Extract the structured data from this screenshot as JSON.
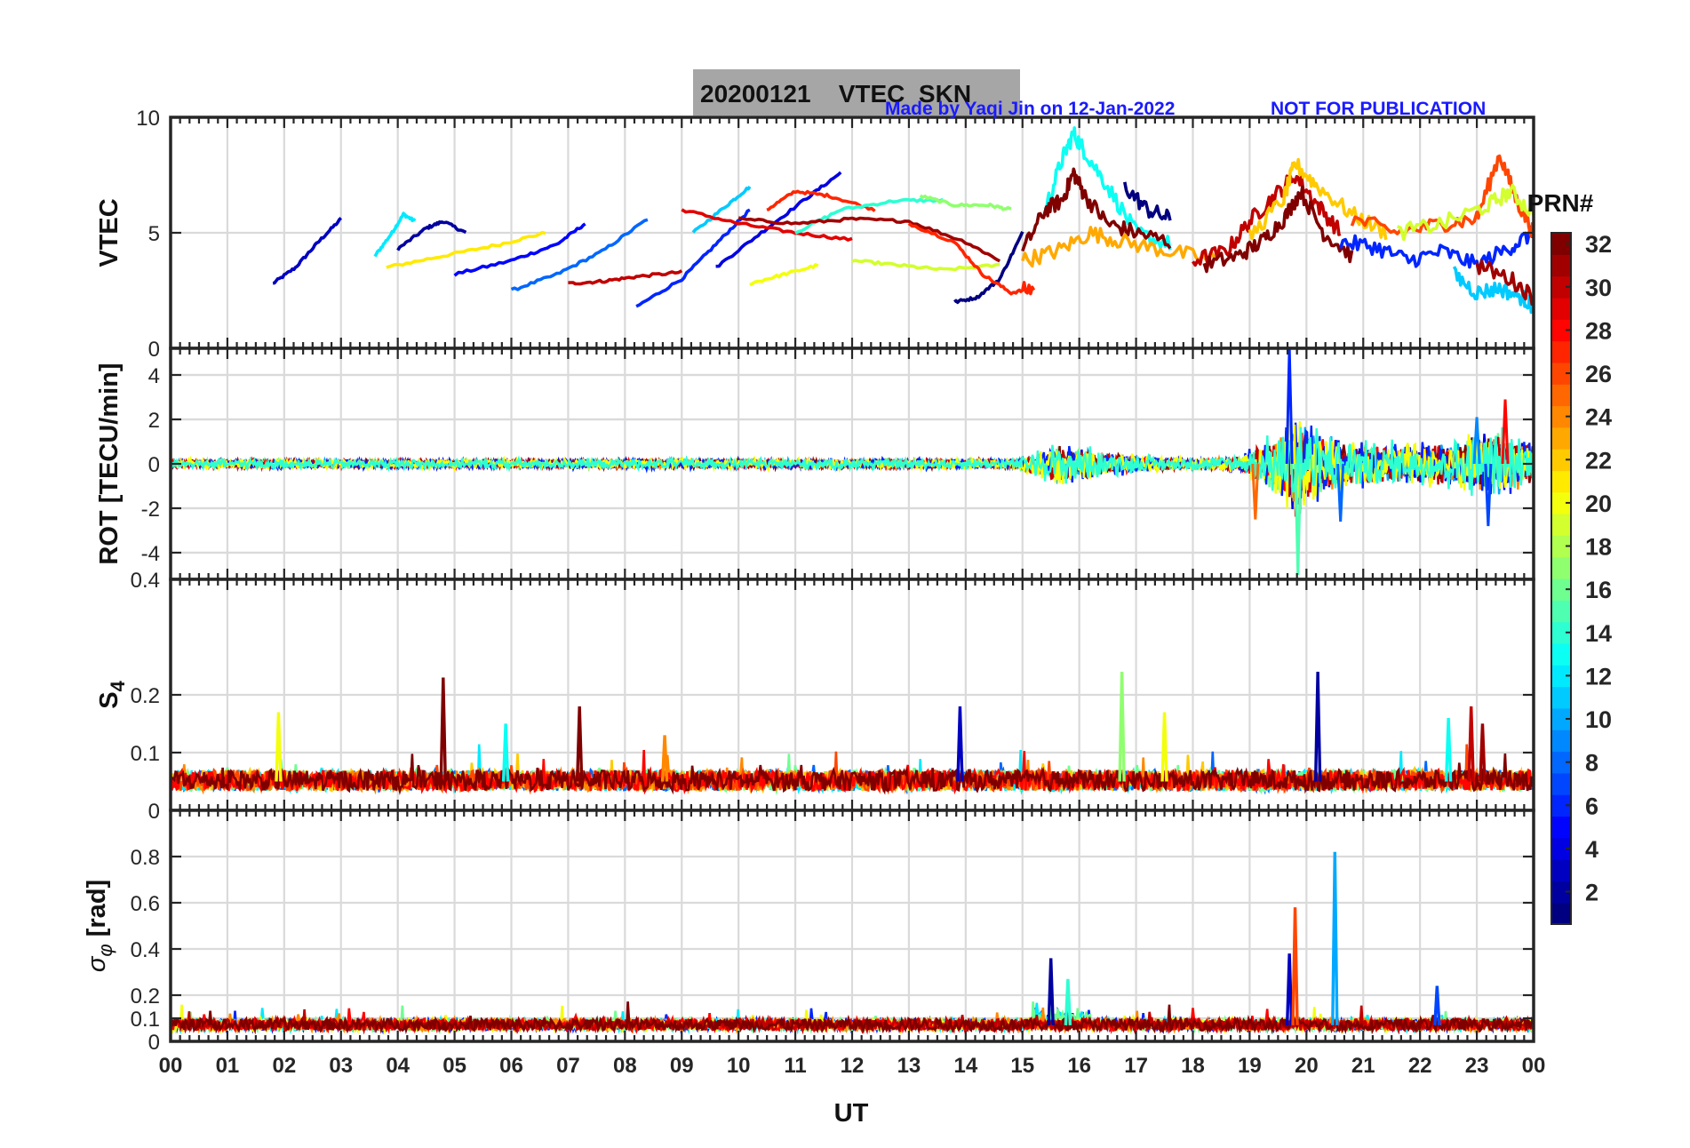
{
  "header": {
    "title": "20200121    VTEC  SKN",
    "credit": "Made by Yaqi Jin on 12-Jan-2022",
    "notice": "NOT FOR PUBLICATION"
  },
  "colors": {
    "title_box": "#a6a6a6",
    "credit_text": "#1a1aff",
    "grid": "#d9d9d9",
    "axes": "#262626"
  },
  "chart_data": [
    {
      "type": "line",
      "panel": "vtec",
      "ylabel": "VTEC",
      "ylim": [
        0,
        10
      ],
      "yticks": [
        0,
        5,
        10
      ],
      "xlim": [
        0,
        24
      ],
      "grid": true,
      "series_description_color_by": "PRN#",
      "series": [
        {
          "prn": 3,
          "x": [
            1.8,
            2.2,
            2.6,
            3.0
          ],
          "y": [
            2.8,
            3.5,
            4.6,
            5.6
          ]
        },
        {
          "prn": 12,
          "x": [
            3.6,
            3.9,
            4.1,
            4.3
          ],
          "y": [
            4.0,
            5.0,
            5.8,
            5.5
          ]
        },
        {
          "prn": 2,
          "x": [
            4.0,
            4.5,
            4.8,
            5.2
          ],
          "y": [
            4.3,
            5.2,
            5.5,
            5.0
          ]
        },
        {
          "prn": 21,
          "x": [
            3.8,
            4.8,
            5.8,
            6.6
          ],
          "y": [
            3.5,
            4.0,
            4.5,
            5.0
          ]
        },
        {
          "prn": 5,
          "x": [
            5.0,
            6.0,
            6.8,
            7.3
          ],
          "y": [
            3.2,
            3.8,
            4.5,
            5.4
          ]
        },
        {
          "prn": 8,
          "x": [
            6.0,
            6.8,
            7.6,
            8.4
          ],
          "y": [
            2.5,
            3.2,
            4.2,
            5.6
          ]
        },
        {
          "prn": 30,
          "x": [
            7.0,
            7.6,
            8.2,
            9.0
          ],
          "y": [
            2.8,
            2.9,
            3.1,
            3.3
          ]
        },
        {
          "prn": 6,
          "x": [
            8.2,
            9.0,
            9.6,
            10.2
          ],
          "y": [
            1.8,
            3.0,
            4.5,
            6.0
          ]
        },
        {
          "prn": 11,
          "x": [
            9.2,
            9.8,
            10.2
          ],
          "y": [
            5.0,
            6.2,
            7.0
          ]
        },
        {
          "prn": 4,
          "x": [
            9.6,
            10.4,
            11.2,
            11.8
          ],
          "y": [
            3.5,
            5.0,
            6.5,
            7.6
          ]
        },
        {
          "prn": 29,
          "x": [
            9.0,
            10.0,
            11.0,
            12.0
          ],
          "y": [
            6.0,
            5.4,
            5.0,
            4.7
          ]
        },
        {
          "prn": 27,
          "x": [
            10.5,
            11.0,
            11.6,
            12.4
          ],
          "y": [
            6.0,
            6.8,
            6.6,
            6.0
          ]
        },
        {
          "prn": 14,
          "x": [
            11.0,
            11.8,
            12.8,
            13.6
          ],
          "y": [
            5.0,
            6.0,
            6.4,
            6.4
          ]
        },
        {
          "prn": 17,
          "x": [
            13.2,
            13.8,
            14.4,
            14.8
          ],
          "y": [
            6.6,
            6.2,
            6.2,
            6.0
          ]
        },
        {
          "prn": 19,
          "x": [
            12.0,
            12.8,
            13.6,
            14.6
          ],
          "y": [
            3.8,
            3.6,
            3.4,
            3.6
          ]
        },
        {
          "prn": 20,
          "x": [
            10.2,
            10.8,
            11.4
          ],
          "y": [
            2.8,
            3.2,
            3.6
          ]
        },
        {
          "prn": 31,
          "x": [
            10.0,
            11.0,
            12.0,
            13.0,
            14.0,
            14.6
          ],
          "y": [
            5.6,
            5.4,
            5.6,
            5.5,
            4.6,
            3.8
          ]
        },
        {
          "prn": 1,
          "x": [
            13.8,
            14.2,
            14.6,
            15.0
          ],
          "y": [
            2.0,
            2.2,
            3.0,
            5.0
          ]
        },
        {
          "prn": 27,
          "x": [
            13.0,
            13.8,
            14.3,
            14.8,
            15.2
          ],
          "y": [
            5.4,
            4.6,
            3.2,
            2.4,
            2.6
          ]
        },
        {
          "prn": 13,
          "x": [
            15.4,
            15.7,
            15.9,
            16.1,
            16.5,
            17.0,
            17.6
          ],
          "y": [
            6.0,
            8.2,
            9.3,
            8.5,
            7.0,
            5.0,
            4.5
          ]
        },
        {
          "prn": 32,
          "x": [
            15.0,
            15.4,
            15.7,
            15.9,
            16.1,
            16.5,
            17.0,
            17.6
          ],
          "y": [
            4.2,
            6.0,
            6.4,
            7.6,
            6.6,
            5.4,
            5.0,
            4.6
          ]
        },
        {
          "prn": 23,
          "x": [
            15.0,
            15.6,
            16.2,
            16.8,
            17.6,
            18.4
          ],
          "y": [
            3.8,
            4.2,
            5.0,
            4.6,
            4.2,
            3.8
          ]
        },
        {
          "prn": 1,
          "x": [
            16.8,
            17.2,
            17.6
          ],
          "y": [
            7.0,
            6.0,
            5.6
          ]
        },
        {
          "prn": 30,
          "x": [
            18.0,
            18.6,
            19.0,
            19.4,
            19.8,
            20.2,
            20.6
          ],
          "y": [
            3.8,
            4.2,
            5.5,
            6.5,
            7.5,
            6.2,
            5.0
          ]
        },
        {
          "prn": 32,
          "x": [
            18.2,
            18.8,
            19.2,
            19.6,
            19.9,
            20.3,
            20.8
          ],
          "y": [
            3.6,
            4.0,
            4.6,
            5.6,
            6.8,
            5.0,
            4.0
          ]
        },
        {
          "prn": 22,
          "x": [
            19.0,
            19.6,
            19.8,
            20.2,
            20.8,
            21.4
          ],
          "y": [
            4.8,
            6.5,
            8.0,
            7.0,
            5.8,
            5.0
          ]
        },
        {
          "prn": 6,
          "x": [
            20.6,
            21.2,
            21.8,
            22.4,
            23.0,
            23.6,
            24.0
          ],
          "y": [
            4.6,
            4.4,
            3.8,
            4.2,
            3.6,
            4.4,
            5.0
          ]
        },
        {
          "prn": 26,
          "x": [
            20.8,
            21.6,
            22.4,
            23.0,
            23.4,
            23.7,
            24.0
          ],
          "y": [
            5.6,
            5.0,
            5.4,
            5.6,
            8.4,
            6.4,
            5.0
          ]
        },
        {
          "prn": 11,
          "x": [
            22.6,
            23.0,
            23.4,
            23.8,
            24.0
          ],
          "y": [
            3.2,
            2.4,
            2.6,
            2.2,
            1.8
          ]
        },
        {
          "prn": 19,
          "x": [
            21.6,
            22.4,
            23.2,
            23.6,
            24.0
          ],
          "y": [
            5.0,
            5.4,
            6.2,
            6.8,
            5.8
          ]
        },
        {
          "prn": 31,
          "x": [
            23.0,
            23.6,
            24.0
          ],
          "y": [
            3.6,
            3.0,
            2.2
          ]
        }
      ]
    },
    {
      "type": "line",
      "panel": "rot",
      "ylabel": "ROT [TECU/min]",
      "ylim": [
        -5.2,
        5.2
      ],
      "yticks": [
        -4,
        -2,
        0,
        2,
        4
      ],
      "xlim": [
        0,
        24
      ],
      "grid": true,
      "envelope": {
        "x": [
          0,
          14.8,
          15.2,
          15.6,
          16.0,
          16.4,
          16.8,
          17.2,
          18.0,
          18.8,
          19.2,
          19.6,
          19.8,
          20.0,
          20.4,
          20.8,
          21.6,
          22.4,
          23.0,
          23.4,
          24.0
        ],
        "amp": [
          0.35,
          0.4,
          0.9,
          1.6,
          1.4,
          1.0,
          0.8,
          0.6,
          0.4,
          0.6,
          1.6,
          2.8,
          5.2,
          3.2,
          2.4,
          1.8,
          1.6,
          1.8,
          2.6,
          2.8,
          1.6
        ]
      },
      "spikes": [
        {
          "x": 19.7,
          "y": 5.2,
          "prn": 6
        },
        {
          "x": 19.85,
          "y": -5.0,
          "prn": 15
        },
        {
          "x": 23.0,
          "y": 2.1,
          "prn": 9
        },
        {
          "x": 23.2,
          "y": -2.8,
          "prn": 7
        },
        {
          "x": 23.5,
          "y": 2.9,
          "prn": 28
        },
        {
          "x": 20.6,
          "y": -2.6,
          "prn": 8
        },
        {
          "x": 19.1,
          "y": -2.5,
          "prn": 25
        }
      ]
    },
    {
      "type": "line",
      "panel": "s4",
      "ylabel": "S4",
      "ylim": [
        0,
        0.4
      ],
      "yticks": [
        0,
        0.1,
        0.2,
        0.4
      ],
      "xlim": [
        0,
        24
      ],
      "grid": true,
      "baseline": 0.05,
      "spikes": [
        {
          "x": 4.8,
          "y": 0.23,
          "prn": 32
        },
        {
          "x": 1.9,
          "y": 0.17,
          "prn": 20
        },
        {
          "x": 7.2,
          "y": 0.18,
          "prn": 32
        },
        {
          "x": 13.9,
          "y": 0.18,
          "prn": 3
        },
        {
          "x": 16.75,
          "y": 0.24,
          "prn": 17
        },
        {
          "x": 17.5,
          "y": 0.17,
          "prn": 20
        },
        {
          "x": 20.2,
          "y": 0.24,
          "prn": 2
        },
        {
          "x": 22.5,
          "y": 0.16,
          "prn": 13
        },
        {
          "x": 22.9,
          "y": 0.18,
          "prn": 30
        },
        {
          "x": 23.1,
          "y": 0.15,
          "prn": 31
        },
        {
          "x": 5.9,
          "y": 0.15,
          "prn": 13
        },
        {
          "x": 8.7,
          "y": 0.13,
          "prn": 24
        }
      ]
    },
    {
      "type": "line",
      "panel": "sigma_phi",
      "ylabel": "σφ [rad]",
      "ylim": [
        0,
        1.0
      ],
      "yticks": [
        0,
        0.1,
        0.2,
        0.4,
        0.6,
        0.8
      ],
      "xlim": [
        0,
        24
      ],
      "grid": true,
      "baseline": 0.07,
      "spikes": [
        {
          "x": 15.5,
          "y": 0.36,
          "prn": 2
        },
        {
          "x": 15.8,
          "y": 0.27,
          "prn": 14
        },
        {
          "x": 19.7,
          "y": 0.38,
          "prn": 3
        },
        {
          "x": 19.8,
          "y": 0.58,
          "prn": 26
        },
        {
          "x": 20.5,
          "y": 0.82,
          "prn": 10
        },
        {
          "x": 22.3,
          "y": 0.24,
          "prn": 7
        }
      ]
    }
  ],
  "x_axis": {
    "xlabel": "UT",
    "ticklabels": [
      "00",
      "01",
      "02",
      "03",
      "04",
      "05",
      "06",
      "07",
      "08",
      "09",
      "10",
      "11",
      "12",
      "13",
      "14",
      "15",
      "16",
      "17",
      "18",
      "19",
      "20",
      "21",
      "22",
      "23",
      "00"
    ]
  },
  "colorbar": {
    "label": "PRN#",
    "range": [
      1,
      32
    ],
    "colormap": "jet",
    "ticks": [
      "32",
      "30",
      "28",
      "26",
      "24",
      "22",
      "20",
      "18",
      "16",
      "14",
      "12",
      "10",
      "8",
      "6",
      "4",
      "2"
    ]
  }
}
